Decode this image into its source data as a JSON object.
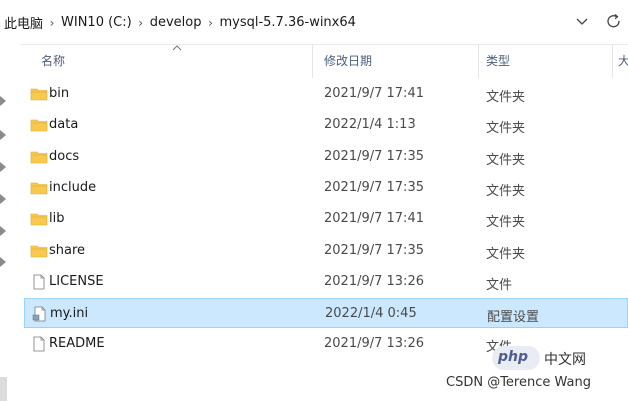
{
  "address_bar": {
    "crumbs": [
      "此电脑",
      "WIN10 (C:)",
      "develop",
      "mysql-5.7.36-winx64"
    ]
  },
  "columns": {
    "name": "名称",
    "date": "修改日期",
    "type": "类型",
    "size_partial": "大"
  },
  "files": [
    {
      "name": "bin",
      "date": "2021/9/7 17:41",
      "type": "文件夹",
      "icon": "folder-icon"
    },
    {
      "name": "data",
      "date": "2022/1/4 1:13",
      "type": "文件夹",
      "icon": "folder-icon"
    },
    {
      "name": "docs",
      "date": "2021/9/7 17:35",
      "type": "文件夹",
      "icon": "folder-icon"
    },
    {
      "name": "include",
      "date": "2021/9/7 17:35",
      "type": "文件夹",
      "icon": "folder-icon"
    },
    {
      "name": "lib",
      "date": "2021/9/7 17:41",
      "type": "文件夹",
      "icon": "folder-icon"
    },
    {
      "name": "share",
      "date": "2021/9/7 17:35",
      "type": "文件夹",
      "icon": "folder-icon"
    },
    {
      "name": "LICENSE",
      "date": "2021/9/7 13:26",
      "type": "文件",
      "icon": "file-icon"
    },
    {
      "name": "my.ini",
      "date": "2022/1/4 0:45",
      "type": "配置设置",
      "icon": "settings-file-icon",
      "selected": true
    },
    {
      "name": "README",
      "date": "2021/9/7 13:26",
      "type": "文件",
      "icon": "file-icon"
    }
  ],
  "watermark": {
    "logo_text": "php",
    "site_text": "中文网",
    "credit": "CSDN @Terence Wang"
  },
  "colors": {
    "selection_bg": "#cce8ff",
    "selection_border": "#99d1ff",
    "folder": "#f8c94f",
    "header_text": "#4c607a"
  }
}
